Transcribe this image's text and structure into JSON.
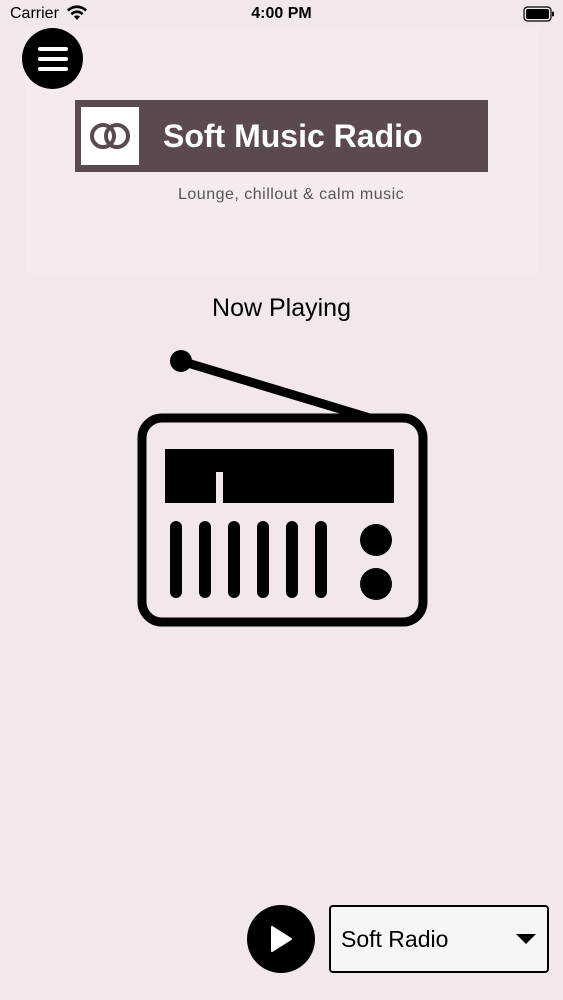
{
  "status_bar": {
    "carrier": "Carrier",
    "time": "4:00 PM",
    "wifi_icon": "wifi-icon",
    "battery_icon": "battery-icon"
  },
  "header": {
    "menu_icon": "hamburger-menu-icon",
    "logo_icon": "interlocking-rings-icon",
    "logo_text": "Soft Music Radio",
    "tagline": "Lounge, chillout & calm music"
  },
  "player": {
    "now_playing_label": "Now Playing",
    "artwork_icon": "radio-icon",
    "play_icon": "play-icon",
    "selected_station": "Soft Radio",
    "dropdown_icon": "caret-down-icon"
  },
  "colors": {
    "background": "#f2e8ea",
    "logo_background": "#5a4a4d",
    "button": "#000000"
  }
}
